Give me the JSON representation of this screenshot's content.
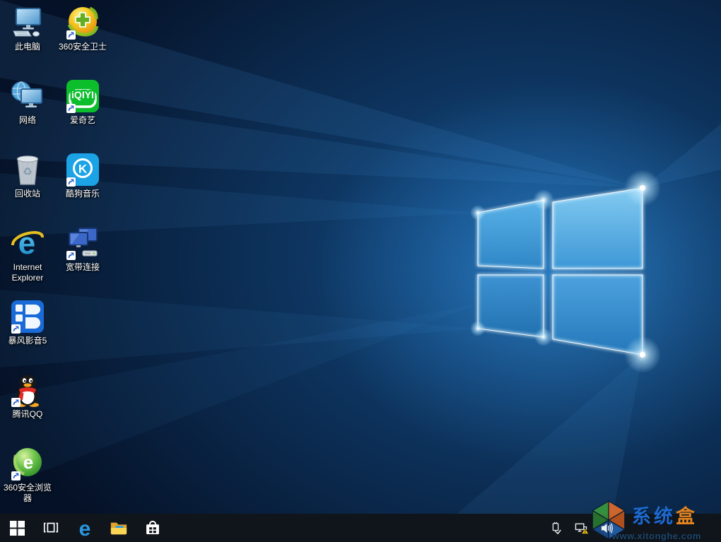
{
  "wallpaper": {
    "base_color": "#0a2342",
    "beam_color": "#55b4ff",
    "logo_edge_color": "#eafaff"
  },
  "desktop_icons": [
    {
      "name": "this-pc",
      "label": "此电脑",
      "shortcut": false
    },
    {
      "name": "360-safe",
      "label": "360安全卫士",
      "shortcut": true
    },
    {
      "name": "network",
      "label": "网络",
      "shortcut": false
    },
    {
      "name": "iqiyi",
      "label": "爱奇艺",
      "shortcut": true
    },
    {
      "name": "recycle-bin",
      "label": "回收站",
      "shortcut": false
    },
    {
      "name": "kugou-music",
      "label": "酷狗音乐",
      "shortcut": true
    },
    {
      "name": "internet-explorer",
      "label": "Internet Explorer",
      "shortcut": false
    },
    {
      "name": "broadband",
      "label": "宽带连接",
      "shortcut": true
    },
    {
      "name": "baofeng-player-5",
      "label": "暴风影音5",
      "shortcut": true
    },
    {
      "name": "tencent-qq",
      "label": "腾讯QQ",
      "shortcut": true
    },
    {
      "name": "360-browser",
      "label": "360安全浏览器",
      "shortcut": true
    }
  ],
  "iqiyi_logo_text": "iQIYI",
  "kugou_letter": "K",
  "ie_letter": "e",
  "browser360_letter": "e",
  "taskbar": {
    "background": "#10151c",
    "buttons": [
      "start-icon",
      "task-view-icon",
      "edge-icon",
      "file-explorer-icon",
      "store-icon"
    ],
    "tray_icons": [
      "usb-icon",
      "network-warning-icon",
      "volume-icon"
    ]
  },
  "watermark": {
    "site_name_primary": "系统",
    "site_name_accent": "盒",
    "site_url": "www.xitonghe.com",
    "primary_color": "#1e6fd8",
    "accent_color": "#f08a1e",
    "url_color": "#1d4a73"
  }
}
